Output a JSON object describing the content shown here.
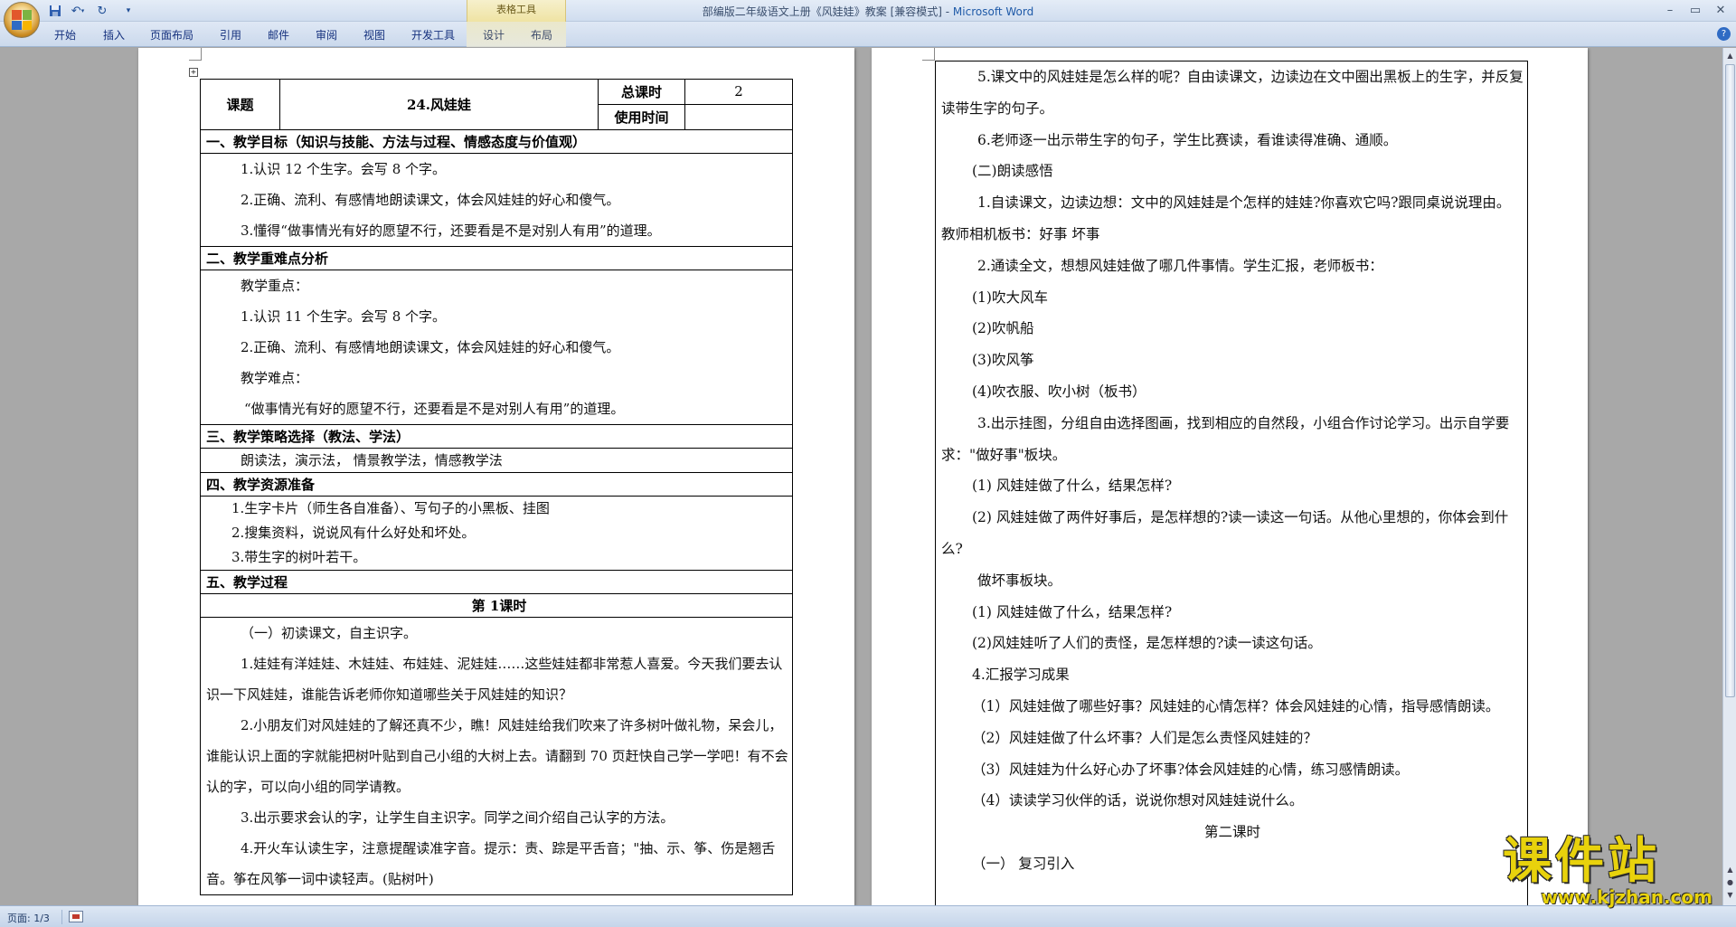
{
  "window": {
    "title": "部编版二年级语文上册《风娃娃》教案 [兼容模式] - ",
    "app_name": "Microsoft Word",
    "context_tab_group": "表格工具"
  },
  "ribbon": {
    "tabs": [
      "开始",
      "插入",
      "页面布局",
      "引用",
      "邮件",
      "审阅",
      "视图",
      "开发工具"
    ],
    "context_tabs": [
      "设计",
      "布局"
    ]
  },
  "icons": {
    "office_button": "office-logo-icon",
    "save": "save-icon",
    "undo": "undo-icon",
    "redo": "redo-icon",
    "customize": "customize-qat-icon",
    "minimize": "minimize-icon",
    "restore": "restore-icon",
    "close": "close-icon",
    "help": "help-icon"
  },
  "page1": {
    "header": {
      "topic_label": "课题",
      "topic_value": "24.风娃娃",
      "total_hours_label": "总课时",
      "total_hours_value": "2",
      "use_time_label": "使用时间",
      "use_time_value": ""
    },
    "sections": {
      "goals_title": "一、教学目标（知识与技能、方法与过程、情感态度与价值观）",
      "goals": [
        "1.认识 12 个生字。会写 8 个字。",
        "2.正确、流利、有感情地朗读课文，体会风娃娃的好心和傻气。",
        "3.懂得“做事情光有好的愿望不行，还要看是不是对别人有用”的道理。"
      ],
      "focus_title": "二、教学重难点分析",
      "focus": [
        "教学重点：",
        "1.认识 11 个生字。会写 8 个字。",
        "2.正确、流利、有感情地朗读课文，体会风娃娃的好心和傻气。",
        "教学难点：",
        "“做事情光有好的愿望不行，还要看是不是对别人有用”的道理。"
      ],
      "strategy_title": "三、教学策略选择（教法、学法）",
      "strategy": "朗读法，演示法， 情景教学法，情感教学法",
      "resources_title": "四、教学资源准备",
      "resources": [
        "1.生字卡片（师生各自准备）、写句子的小黑板、挂图",
        "2.搜集资料，说说风有什么好处和坏处。",
        "3.带生字的树叶若干。"
      ],
      "process_title": "五、教学过程",
      "lesson1_title": "第 1课时",
      "process": [
        "（一）初读课文，自主识字。",
        "1.娃娃有洋娃娃、木娃娃、布娃娃、泥娃娃……这些娃娃都非常惹人喜爱。今天我们要去认识一下风娃娃，谁能告诉老师你知道哪些关于风娃娃的知识？",
        "2.小朋友们对风娃娃的了解还真不少，瞧！风娃娃给我们吹来了许多树叶做礼物，呆会儿，谁能认识上面的字就能把树叶贴到自己小组的大树上去。请翻到 70 页赶快自己学一学吧！有不会认的字，可以向小组的同学请教。",
        "3.出示要求会认的字，让学生自主识字。同学之间介绍自己认字的方法。",
        "4.开火车认读生字，注意提醒读准字音。提示：责、踪是平舌音；\"抽、示、筝、伤是翘舌音。筝在风筝一词中读轻声。(贴树叶)"
      ]
    }
  },
  "page2": {
    "lines": [
      "5.课文中的风娃娃是怎么样的呢？自由读课文，边读边在文中圈出黑板上的生字，并反复读带生字的句子。",
      "6.老师逐一出示带生字的句子，学生比赛读，看谁读得准确、通顺。",
      "(二)朗读感悟",
      "1.自读课文，边读边想：文中的风娃娃是个怎样的娃娃?你喜欢它吗?跟同桌说说理由。教师相机板书：好事 坏事",
      "2.通读全文，想想风娃娃做了哪几件事情。学生汇报，老师板书：",
      "(1)吹大风车",
      "(2)吹帆船",
      "(3)吹风筝",
      "(4)吹衣服、吹小树（板书）",
      "3.出示挂图，分组自由选择图画，找到相应的自然段，小组合作讨论学习。出示自学要求：\"做好事\"板块。",
      "(1) 风娃娃做了什么，结果怎样?",
      "(2) 风娃娃做了两件好事后，是怎样想的?读一读这一句话。从他心里想的，你体会到什么?",
      "做坏事板块。",
      "(1) 风娃娃做了什么，结果怎样?",
      "(2)风娃娃听了人们的责怪，是怎样想的?读一读这句话。",
      "4.汇报学习成果",
      "（1）风娃娃做了哪些好事？风娃娃的心情怎样？体会风娃娃的心情，指导感情朗读。",
      "（2）风娃娃做了什么坏事？人们是怎么责怪风娃娃的？",
      "（3）风娃娃为什么好心办了坏事?体会风娃娃的心情，练习感情朗读。",
      "（4）读读学习伙伴的话，说说你想对风娃娃说什么。",
      "第二课时",
      "（一） 复习引入"
    ]
  },
  "statusbar": {
    "page_indicator": "页面: 1/3"
  },
  "watermark": {
    "title": "课件站",
    "url": "www.kjzhan.com"
  },
  "colors": {
    "ribbon_bg": "#dfe8f5",
    "workspace_bg": "#a8a8a8",
    "tab_text": "#15317e",
    "watermark_yellow": "#e8d20c"
  }
}
